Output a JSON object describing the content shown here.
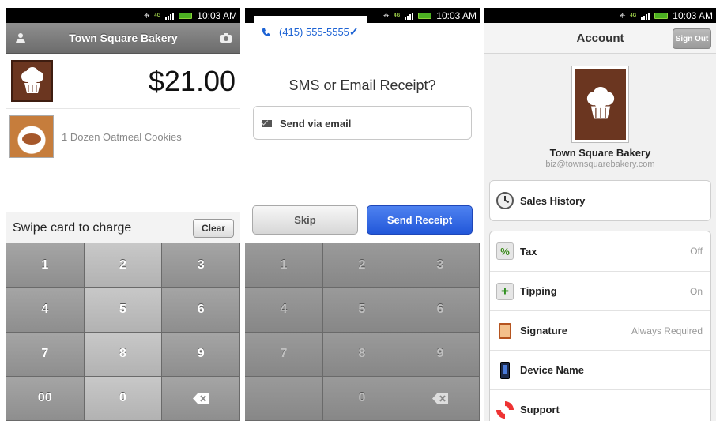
{
  "status_bar": {
    "time": "10:03 AM",
    "network": "4G"
  },
  "screen1": {
    "title": "Town Square Bakery",
    "amount": "$21.00",
    "item_label": "1 Dozen Oatmeal Cookies",
    "swipe_text": "Swipe card to charge",
    "clear_label": "Clear",
    "keys": [
      "1",
      "2",
      "3",
      "4",
      "5",
      "6",
      "7",
      "8",
      "9",
      "00",
      "0",
      "delete"
    ]
  },
  "screen2": {
    "title": "SMS or Email Receipt?",
    "phone_option": "(415) 555-5555",
    "email_option": "Send via email",
    "skip_label": "Skip",
    "send_label": "Send Receipt",
    "keys": [
      "1",
      "2",
      "3",
      "4",
      "5",
      "6",
      "7",
      "8",
      "9",
      "",
      "0",
      "delete"
    ]
  },
  "screen3": {
    "title": "Account",
    "signout_label": "Sign Out",
    "biz_name": "Town Square Bakery",
    "biz_email": "biz@townsquarebakery.com",
    "sales_history": "Sales History",
    "settings": [
      {
        "label": "Tax",
        "value": "Off",
        "icon": "percent-icon"
      },
      {
        "label": "Tipping",
        "value": "On",
        "icon": "plus-icon"
      },
      {
        "label": "Signature",
        "value": "Always Required",
        "icon": "clipboard-icon"
      },
      {
        "label": "Device Name",
        "value": "",
        "icon": "phone-device-icon"
      },
      {
        "label": "Support",
        "value": "",
        "icon": "lifebuoy-icon"
      }
    ]
  },
  "colors": {
    "accent_blue": "#2257d9",
    "logo_brown": "#6b3620",
    "battery_green": "#4caf22"
  }
}
